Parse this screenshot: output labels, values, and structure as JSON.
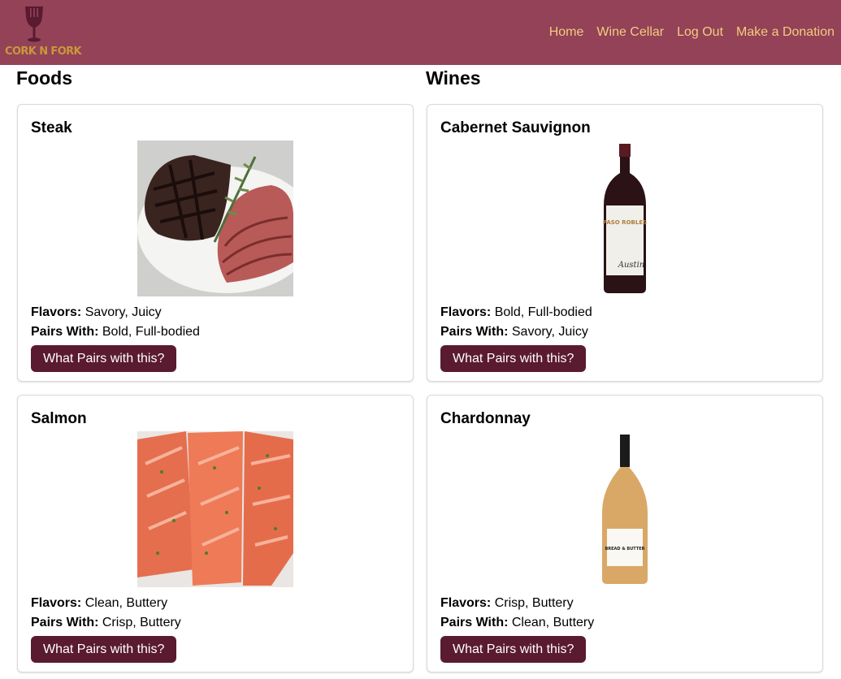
{
  "brand": {
    "logo_text": "CORK N FORK"
  },
  "nav": {
    "items": [
      {
        "label": "Home"
      },
      {
        "label": "Wine Cellar"
      },
      {
        "label": "Log Out"
      },
      {
        "label": "Make a Donation"
      }
    ]
  },
  "foods": {
    "heading": "Foods",
    "items": [
      {
        "name": "Steak",
        "flavors_label": "Flavors:",
        "flavors": "Savory, Juicy",
        "pairs_label": "Pairs With:",
        "pairs": "Bold, Full-bodied",
        "button": "What Pairs with this?"
      },
      {
        "name": "Salmon",
        "flavors_label": "Flavors:",
        "flavors": "Clean, Buttery",
        "pairs_label": "Pairs With:",
        "pairs": "Crisp, Buttery",
        "button": "What Pairs with this?"
      }
    ]
  },
  "wines": {
    "heading": "Wines",
    "items": [
      {
        "name": "Cabernet Sauvignon",
        "label_text": "PASO ROBLES",
        "label_script": "Austin",
        "flavors_label": "Flavors:",
        "flavors": "Bold, Full-bodied",
        "pairs_label": "Pairs With:",
        "pairs": "Savory, Juicy",
        "button": "What Pairs with this?"
      },
      {
        "name": "Chardonnay",
        "label_text": "BREAD & BUTTER",
        "flavors_label": "Flavors:",
        "flavors": "Crisp, Buttery",
        "pairs_label": "Pairs With:",
        "pairs": "Clean, Buttery",
        "button": "What Pairs with this?"
      }
    ]
  },
  "colors": {
    "navbar": "#934258",
    "nav_link": "#f3cc7d",
    "logo_text": "#c9983b",
    "button": "#5a1a30"
  }
}
